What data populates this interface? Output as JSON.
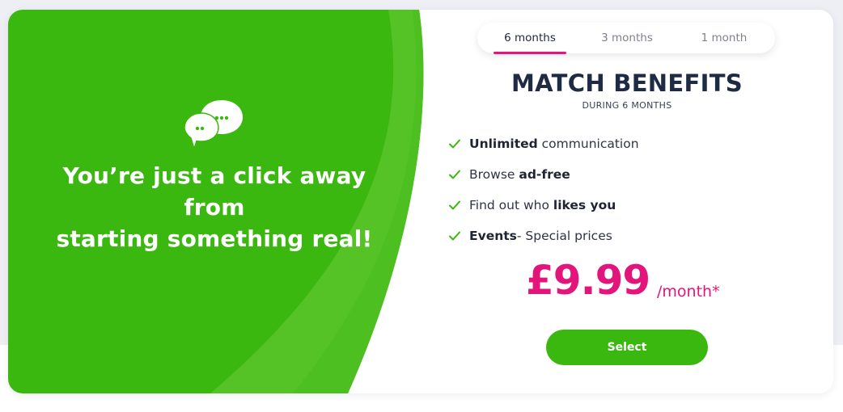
{
  "colors": {
    "green_primary": "#3bb80f",
    "green_light": "#55c326",
    "pink_accent": "#e4157a",
    "navy_text": "#1f2a44"
  },
  "promo": {
    "icon": "chat-bubbles-icon",
    "headline_lines": [
      "You’re just a click away",
      "from",
      "starting something real!"
    ]
  },
  "tabs": [
    {
      "label": "6 months",
      "active": true
    },
    {
      "label": "3 months",
      "active": false
    },
    {
      "label": "1 month",
      "active": false
    }
  ],
  "benefits": {
    "title": "MATCH BENEFITS",
    "subtitle": "DURING 6 MONTHS",
    "items": [
      {
        "bold": "Unlimited",
        "rest": " communication",
        "bold_first": true
      },
      {
        "bold": "ad-free",
        "rest": "Browse ",
        "bold_first": false
      },
      {
        "bold": "likes you",
        "rest": "Find out who ",
        "bold_first": false
      },
      {
        "bold": "Events",
        "rest": "- Special prices",
        "bold_first": true
      }
    ],
    "check_icon": "check-icon"
  },
  "price": {
    "amount": "£9.99",
    "period": "/month*"
  },
  "cta": {
    "label": "Select"
  }
}
